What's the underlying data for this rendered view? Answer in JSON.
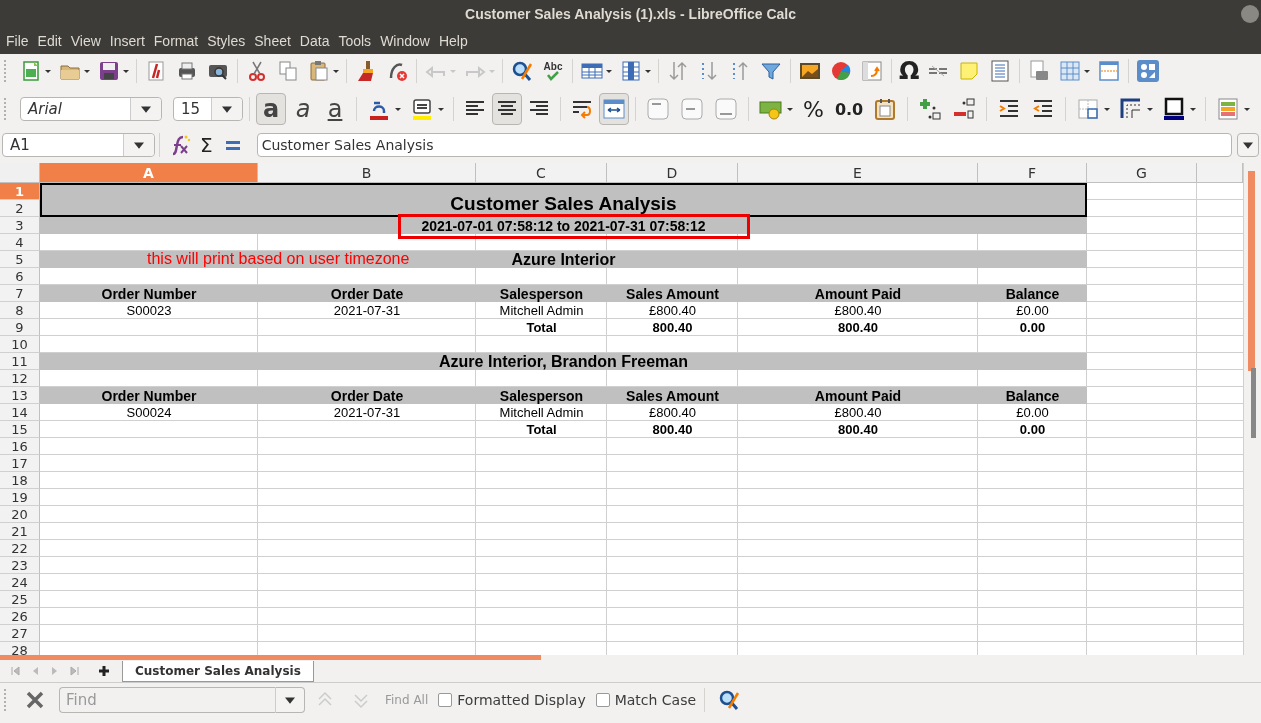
{
  "window": {
    "title": "Customer Sales Analysis (1).xls - LibreOffice Calc"
  },
  "menu": [
    "File",
    "Edit",
    "View",
    "Insert",
    "Format",
    "Styles",
    "Sheet",
    "Data",
    "Tools",
    "Window",
    "Help"
  ],
  "standard_toolbar": {
    "spellcheck_glyph": "Abc",
    "special_character_glyph": "Ω"
  },
  "format_toolbar": {
    "font_name": "Arial",
    "font_size": "15",
    "style_buttons": [
      {
        "kind": "bold",
        "glyph": "a",
        "selected": true
      },
      {
        "kind": "italic",
        "glyph": "a",
        "selected": false
      },
      {
        "kind": "underline",
        "glyph": "a",
        "selected": false
      }
    ],
    "align_buttons": [
      {
        "kind": "left",
        "selected": false
      },
      {
        "kind": "center",
        "selected": true
      },
      {
        "kind": "right",
        "selected": false
      }
    ],
    "wrap_selected": false,
    "merge_selected": true,
    "percent_glyph": "%",
    "decimal_glyph": "0.0"
  },
  "formula_bar": {
    "cell_reference": "A1",
    "sum_glyph": "Σ",
    "content": "Customer Sales Analysis"
  },
  "sheet": {
    "columns": [
      {
        "label": "A",
        "selected": true
      },
      {
        "label": "B",
        "selected": false
      },
      {
        "label": "C",
        "selected": false
      },
      {
        "label": "D",
        "selected": false
      },
      {
        "label": "E",
        "selected": false
      },
      {
        "label": "F",
        "selected": false
      },
      {
        "label": "G",
        "selected": false
      }
    ],
    "rows": [
      {
        "number": "1",
        "selected": true,
        "kind": "title",
        "text": "Customer Sales Analysis"
      },
      {
        "number": "2",
        "selected": false,
        "kind": "merged"
      },
      {
        "number": "3",
        "selected": false,
        "kind": "subtitle",
        "text": "2021-07-01 07:58:12 to 2021-07-31 07:58:12"
      },
      {
        "number": "4",
        "selected": false,
        "kind": "blank"
      },
      {
        "number": "5",
        "selected": false,
        "kind": "group",
        "text": "Azure Interior",
        "note": "this will print based on user timezone"
      },
      {
        "number": "6",
        "selected": false,
        "kind": "blank"
      },
      {
        "number": "7",
        "selected": false,
        "kind": "header",
        "cells": {
          "A": "Order Number",
          "B": "Order Date",
          "C": "Salesperson",
          "D": "Sales Amount",
          "E": "Amount Paid",
          "F": "Balance"
        }
      },
      {
        "number": "8",
        "selected": false,
        "kind": "data",
        "cells": {
          "A": "S00023",
          "B": "2021-07-31",
          "C": "Mitchell Admin",
          "D": "£800.40",
          "E": "£800.40",
          "F": "£0.00"
        }
      },
      {
        "number": "9",
        "selected": false,
        "kind": "total",
        "cells": {
          "C": "Total",
          "D": "800.40",
          "E": "800.40",
          "F": "0.00"
        }
      },
      {
        "number": "10",
        "selected": false,
        "kind": "blank"
      },
      {
        "number": "11",
        "selected": false,
        "kind": "group",
        "text": "Azure Interior, Brandon Freeman"
      },
      {
        "number": "12",
        "selected": false,
        "kind": "blank"
      },
      {
        "number": "13",
        "selected": false,
        "kind": "header",
        "cells": {
          "A": "Order Number",
          "B": "Order Date",
          "C": "Salesperson",
          "D": "Sales Amount",
          "E": "Amount Paid",
          "F": "Balance"
        }
      },
      {
        "number": "14",
        "selected": false,
        "kind": "data",
        "cells": {
          "A": "S00024",
          "B": "2021-07-31",
          "C": "Mitchell Admin",
          "D": "£800.40",
          "E": "£800.40",
          "F": "£0.00"
        }
      },
      {
        "number": "15",
        "selected": false,
        "kind": "total",
        "cells": {
          "C": "Total",
          "D": "800.40",
          "E": "800.40",
          "F": "0.00"
        }
      },
      {
        "number": "16",
        "selected": false,
        "kind": "blank"
      },
      {
        "number": "17",
        "selected": false,
        "kind": "blank"
      },
      {
        "number": "18",
        "selected": false,
        "kind": "blank"
      },
      {
        "number": "19",
        "selected": false,
        "kind": "blank"
      },
      {
        "number": "20",
        "selected": false,
        "kind": "blank"
      },
      {
        "number": "21",
        "selected": false,
        "kind": "blank"
      },
      {
        "number": "22",
        "selected": false,
        "kind": "blank"
      },
      {
        "number": "23",
        "selected": false,
        "kind": "blank"
      },
      {
        "number": "24",
        "selected": false,
        "kind": "blank"
      },
      {
        "number": "25",
        "selected": false,
        "kind": "blank"
      },
      {
        "number": "26",
        "selected": false,
        "kind": "blank"
      },
      {
        "number": "27",
        "selected": false,
        "kind": "blank"
      },
      {
        "number": "28",
        "selected": false,
        "kind": "blank"
      }
    ]
  },
  "sheet_tabs": [
    {
      "label": "Customer Sales Analysis",
      "selected": true
    }
  ],
  "find_bar": {
    "placeholder": "Find",
    "find_all": "Find All",
    "options": [
      {
        "label": "Formatted Display",
        "checked": false
      },
      {
        "label": "Match Case",
        "checked": false
      }
    ]
  }
}
